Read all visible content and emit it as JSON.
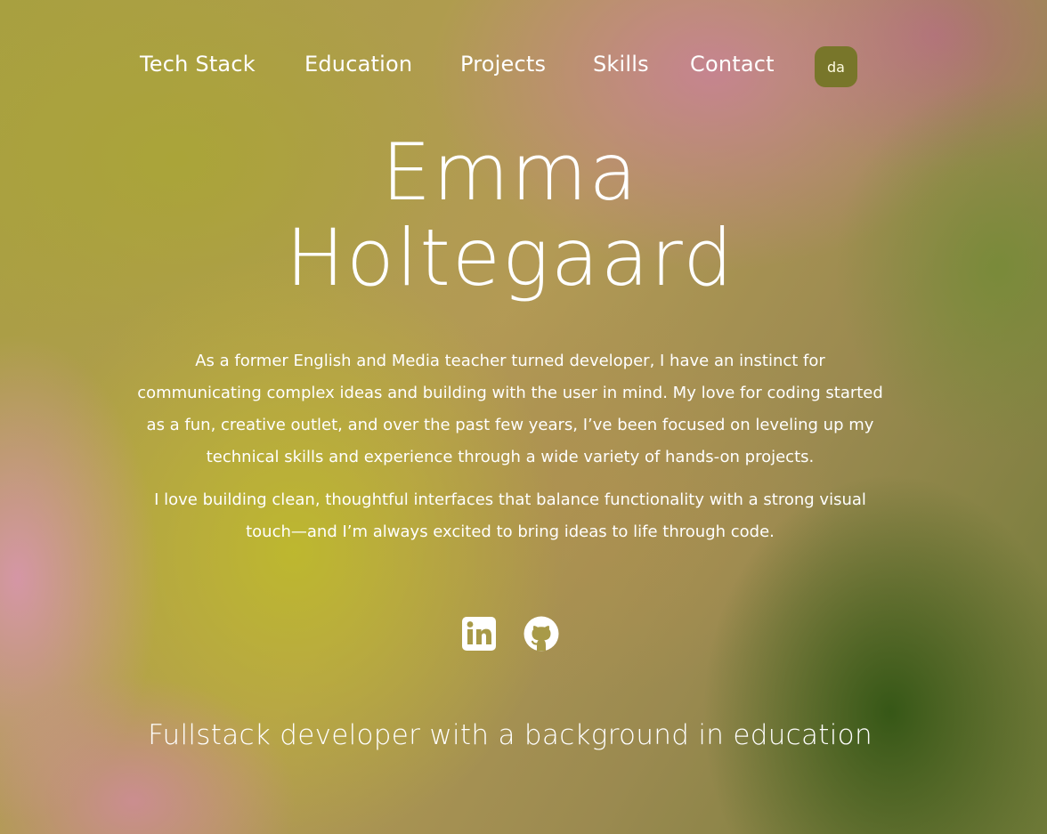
{
  "nav": {
    "items": [
      {
        "label": "Tech Stack"
      },
      {
        "label": "Education"
      },
      {
        "label": "Projects"
      },
      {
        "label": "Skills"
      },
      {
        "label": "Contact"
      }
    ],
    "logo_text": "da"
  },
  "hero": {
    "first_name": "Emma",
    "last_name": "Holtegaard"
  },
  "bio": {
    "paragraph_1": "As a former English and Media teacher turned developer, I have an instinct for communicating complex ideas and building with the user in mind. My love for coding started as a fun, creative outlet, and over the past few years, I’ve been focused on leveling up my technical skills and experience through a wide variety of hands-on projects.",
    "paragraph_2": "I love building clean, thoughtful interfaces that balance functionality with a strong visual touch—and I’m always excited to bring ideas to life through code."
  },
  "socials": {
    "icons": [
      "linkedin-icon",
      "github-icon"
    ]
  },
  "tagline": "Fullstack developer with a background in education",
  "colors": {
    "text": "#ffffff",
    "logo_bg": "#78762a"
  }
}
